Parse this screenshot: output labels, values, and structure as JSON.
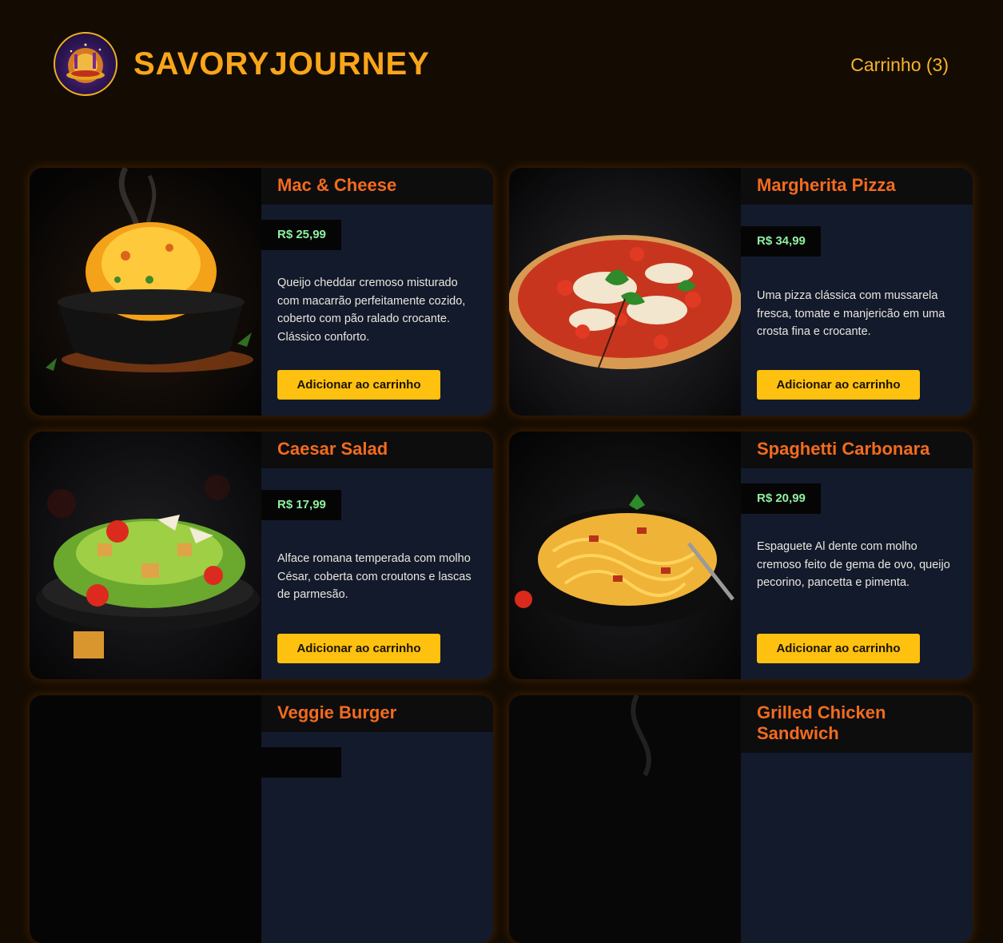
{
  "header": {
    "brand": "SAVORYJOURNEY",
    "cart_label": "Carrinho (3)"
  },
  "menu": {
    "items": [
      {
        "name": "Mac & Cheese",
        "price": "R$ 25,99",
        "description": "Queijo cheddar cremoso misturado com macarrão perfeitamente cozido, coberto com pão ralado crocante. Clássico conforto.",
        "button_label": "Adicionar ao carrinho"
      },
      {
        "name": "Margherita Pizza",
        "price": "R$ 34,99",
        "description": "Uma pizza clássica com mussarela fresca, tomate e manjericão em uma crosta fina e crocante.",
        "button_label": "Adicionar ao carrinho"
      },
      {
        "name": "Caesar Salad",
        "price": "R$ 17,99",
        "description": "Alface romana temperada com molho César, coberta com croutons e lascas de parmesão.",
        "button_label": "Adicionar ao carrinho"
      },
      {
        "name": "Spaghetti Carbonara",
        "price": "R$ 20,99",
        "description": "Espaguete Al dente com molho cremoso feito de gema de ovo, queijo pecorino, pancetta e pimenta.",
        "button_label": "Adicionar ao carrinho"
      },
      {
        "name": "Veggie Burger",
        "price": "",
        "description": "",
        "button_label": ""
      },
      {
        "name": "Grilled Chicken Sandwich",
        "price": "",
        "description": "",
        "button_label": ""
      }
    ]
  },
  "colors": {
    "page_background": "#140c02",
    "brand": "#f9a51b",
    "title_accent": "#f36b1e",
    "price_text": "#8ef0a0",
    "button": "#fec10f",
    "card_body": "#131a2b"
  }
}
